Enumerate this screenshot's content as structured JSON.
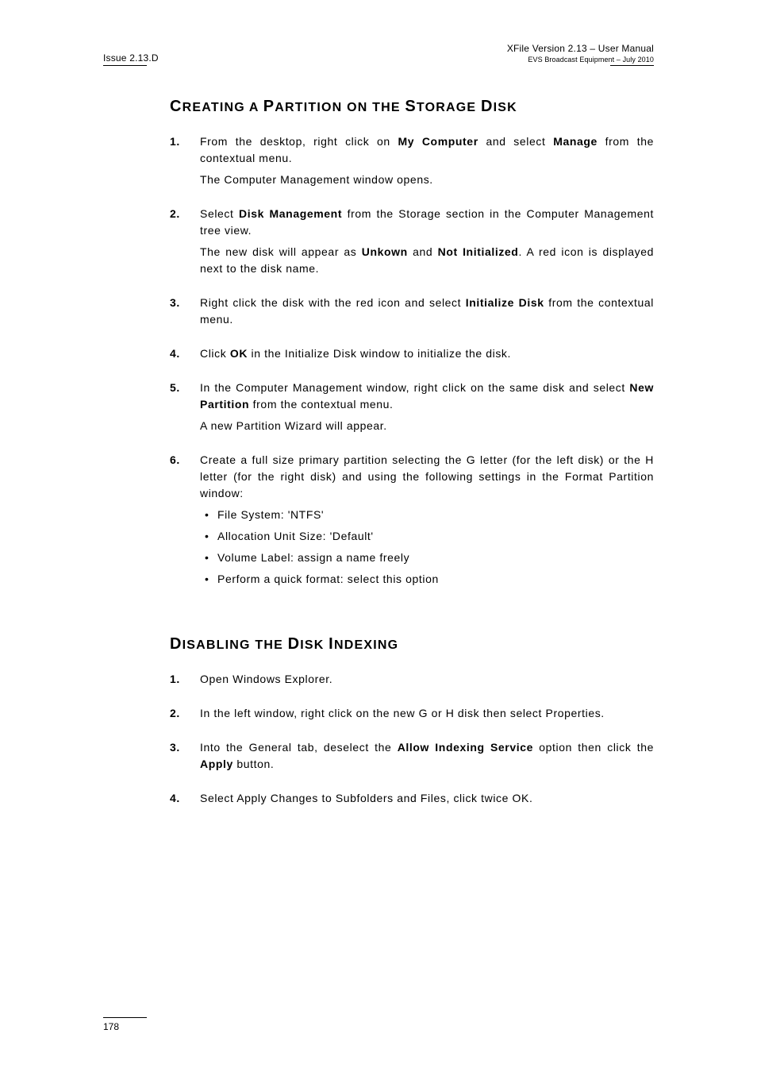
{
  "header": {
    "left": "Issue 2.13.D",
    "right_title": "XFile Version 2.13 – User Manual",
    "right_sub": "EVS Broadcast Equipment – July 2010"
  },
  "sections": [
    {
      "title_caps": "C P S D",
      "title_full": "Creating a Partition on the Storage Disk",
      "title_html_parts": [
        {
          "big": "C"
        },
        {
          "small": "REATING A "
        },
        {
          "big": "P"
        },
        {
          "small": "ARTITION ON THE "
        },
        {
          "big": "S"
        },
        {
          "small": "TORAGE "
        },
        {
          "big": "D"
        },
        {
          "small": "ISK"
        }
      ],
      "steps": [
        {
          "n": "1.",
          "lines": [
            "From the desktop, right click on <b>My Computer</b> and select <b>Manage</b> from the contextual menu.",
            "The Computer Management window opens."
          ]
        },
        {
          "n": "2.",
          "lines": [
            "Select <b>Disk Management</b> from the Storage section in the Computer Management tree view.",
            "The new disk will appear as <b>Unkown</b> and <b>Not Initialized</b>. A red icon is displayed next to the disk name."
          ]
        },
        {
          "n": "3.",
          "lines": [
            "Right click the disk with the red icon and select <b>Initialize Disk</b> from the contextual menu."
          ]
        },
        {
          "n": "4.",
          "lines": [
            "Click <b>OK</b> in the Initialize Disk window to initialize the disk."
          ]
        },
        {
          "n": "5.",
          "lines": [
            "In the Computer Management window, right click on the same disk and select <b>New Partition</b> from the contextual menu.",
            "A new Partition Wizard will appear."
          ]
        },
        {
          "n": "6.",
          "lines": [
            "Create a full size primary partition selecting the G letter (for the left disk) or the H letter (for the right disk) and using the following settings in the Format Partition window:"
          ],
          "bullets": [
            "File System: 'NTFS'",
            "Allocation Unit Size: 'Default'",
            "Volume Label: assign a name freely",
            "Perform a quick format: select this option"
          ]
        }
      ]
    },
    {
      "title_html_parts": [
        {
          "big": "D"
        },
        {
          "small": "ISABLING THE "
        },
        {
          "big": "D"
        },
        {
          "small": "ISK "
        },
        {
          "big": "I"
        },
        {
          "small": "NDEXING"
        }
      ],
      "steps": [
        {
          "n": "1.",
          "lines": [
            "Open Windows Explorer."
          ]
        },
        {
          "n": "2.",
          "lines": [
            "In the left window, right click on the new G or H disk then select Properties."
          ]
        },
        {
          "n": "3.",
          "lines": [
            "Into the General tab, deselect the <b>Allow Indexing Service</b> option then click the <b>Apply</b> button."
          ]
        },
        {
          "n": "4.",
          "lines": [
            "Select Apply Changes to Subfolders and Files, click twice OK."
          ]
        }
      ]
    }
  ],
  "footer": {
    "page_number": "178"
  }
}
